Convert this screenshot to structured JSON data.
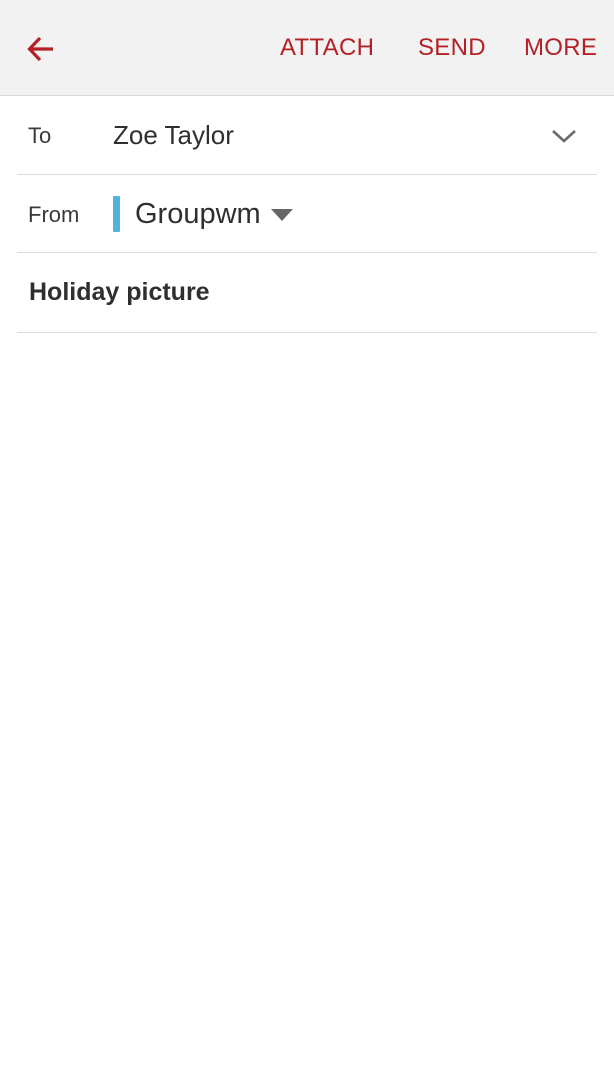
{
  "colors": {
    "accent": "#b32127",
    "account_indicator": "#4fb3de",
    "appbar_background": "#f2f2f2"
  },
  "toolbar": {
    "back_icon": "arrow-left-icon",
    "actions": [
      {
        "label": "ATTACH"
      },
      {
        "label": "SEND"
      },
      {
        "label": "MORE"
      }
    ]
  },
  "compose": {
    "to": {
      "label": "To",
      "value": "Zoe Taylor",
      "expand_icon": "chevron-down-icon"
    },
    "from": {
      "label": "From",
      "value": "Groupwm",
      "dropdown_icon": "caret-down-icon"
    },
    "subject": {
      "value": "Holiday picture"
    },
    "body": {
      "value": ""
    }
  }
}
